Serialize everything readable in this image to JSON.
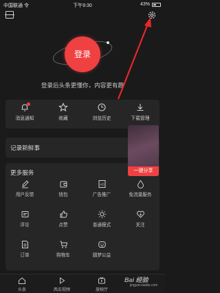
{
  "status_bar": {
    "carrier": "中国联通 令",
    "time": "下午9:30",
    "battery": "43%"
  },
  "login": {
    "button_label": "登录",
    "tip": "登录后头条更懂你，内容更有趣"
  },
  "quick_actions": [
    {
      "label": "消息通知",
      "icon": "bell-icon",
      "has_badge": true
    },
    {
      "label": "收藏",
      "icon": "star-icon"
    },
    {
      "label": "浏览历史",
      "icon": "clock-icon"
    },
    {
      "label": "下载管理",
      "icon": "download-icon"
    }
  ],
  "record": {
    "title": "记录新鲜事"
  },
  "services": {
    "title": "更多服务",
    "items": [
      {
        "label": "用户反馈",
        "icon": "pencil-icon"
      },
      {
        "label": "钱包",
        "icon": "wallet-icon"
      },
      {
        "label": "广告推广",
        "icon": "ad-icon"
      },
      {
        "label": "免流量服务",
        "icon": "drop-icon"
      },
      {
        "label": "评论",
        "icon": "comment-icon"
      },
      {
        "label": "点赞",
        "icon": "thumbs-up-icon"
      },
      {
        "label": "普通模式",
        "icon": "sun-icon"
      },
      {
        "label": "关注",
        "icon": "heart-plus-icon"
      },
      {
        "label": "订单",
        "icon": "order-icon"
      },
      {
        "label": "购物车",
        "icon": "cart-icon"
      },
      {
        "label": "圆梦公益",
        "icon": "charity-icon"
      }
    ]
  },
  "share_popup": {
    "label": "一键分享"
  },
  "tabs": [
    {
      "label": "头条",
      "icon": "home-icon"
    },
    {
      "label": "西瓜视频",
      "icon": "play-icon"
    },
    {
      "label": "放映厅",
      "icon": "tv-icon"
    }
  ],
  "watermark": {
    "line1": "Bai 经验",
    "line2": "jingyan.baidu.com"
  },
  "colors": {
    "accent": "#f04142",
    "background": "#1a1a1a",
    "card": "#262626"
  }
}
